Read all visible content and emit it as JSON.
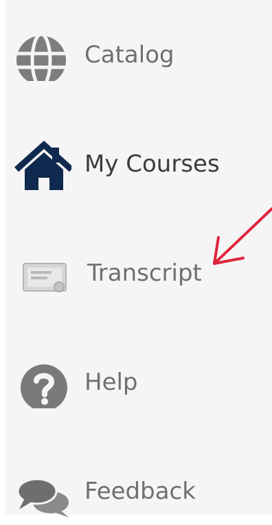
{
  "nav": {
    "items": [
      {
        "label": "Catalog",
        "icon": "globe-icon",
        "active": false
      },
      {
        "label": "My Courses",
        "icon": "home-icon",
        "active": true
      },
      {
        "label": "Transcript",
        "icon": "certificate-icon",
        "active": false
      },
      {
        "label": "Help",
        "icon": "question-circle-icon",
        "active": false
      },
      {
        "label": "Feedback",
        "icon": "chat-bubbles-icon",
        "active": false
      }
    ]
  },
  "colors": {
    "sidebar_background": "#f5f5f5",
    "inactive_icon": "#7a7a7a",
    "active_icon": "#0f2a4e",
    "label_text": "#6f6f6f",
    "annotation_arrow": "#e0243c"
  }
}
